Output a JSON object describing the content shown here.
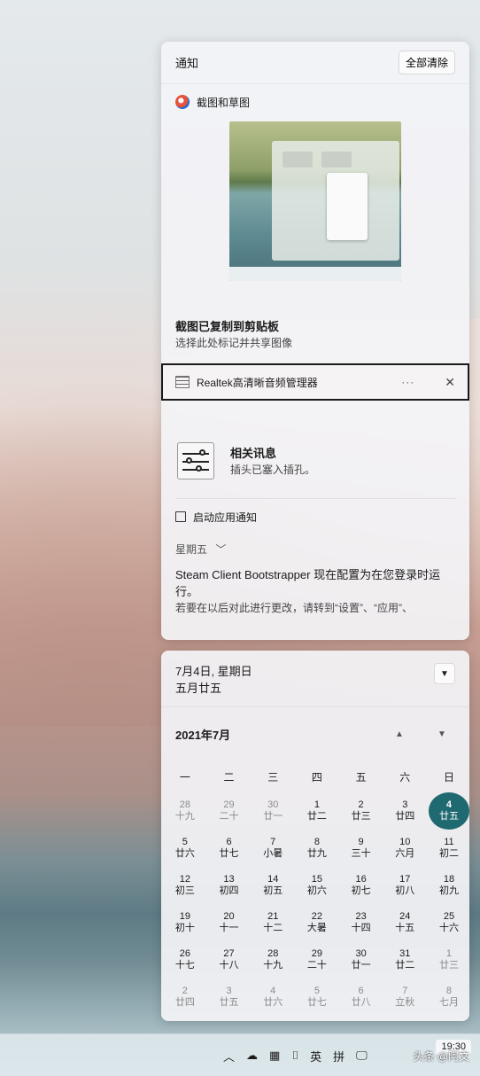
{
  "notifications": {
    "title": "通知",
    "clear_all": "全部清除",
    "snip": {
      "app": "截图和草图",
      "title": "截图已复制到剪贴板",
      "subtitle": "选择此处标记并共享图像"
    },
    "realtek": {
      "app": "Realtek高清晰音频管理器",
      "more": "···",
      "close": "✕",
      "title": "相关讯息",
      "subtitle": "插头已塞入插孔。"
    },
    "launch": "启动应用通知",
    "day_group": "星期五",
    "steam": {
      "title": "Steam Client Bootstrapper 现在配置为在您登录时运行。",
      "subtitle": "若要在以后对此进行更改，请转到“设置”、“应用”、"
    }
  },
  "calendar": {
    "date_line1": "7月4日, 星期日",
    "date_line2": "五月廿五",
    "month": "2021年7月",
    "weekdays": [
      "一",
      "二",
      "三",
      "四",
      "五",
      "六",
      "日"
    ],
    "days": [
      {
        "n": "28",
        "l": "十九",
        "dim": true
      },
      {
        "n": "29",
        "l": "二十",
        "dim": true
      },
      {
        "n": "30",
        "l": "廿一",
        "dim": true
      },
      {
        "n": "1",
        "l": "廿二"
      },
      {
        "n": "2",
        "l": "廿三"
      },
      {
        "n": "3",
        "l": "廿四"
      },
      {
        "n": "4",
        "l": "廿五",
        "today": true
      },
      {
        "n": "5",
        "l": "廿六"
      },
      {
        "n": "6",
        "l": "廿七"
      },
      {
        "n": "7",
        "l": "小暑"
      },
      {
        "n": "8",
        "l": "廿九"
      },
      {
        "n": "9",
        "l": "三十"
      },
      {
        "n": "10",
        "l": "六月"
      },
      {
        "n": "11",
        "l": "初二"
      },
      {
        "n": "12",
        "l": "初三"
      },
      {
        "n": "13",
        "l": "初四"
      },
      {
        "n": "14",
        "l": "初五"
      },
      {
        "n": "15",
        "l": "初六"
      },
      {
        "n": "16",
        "l": "初七"
      },
      {
        "n": "17",
        "l": "初八"
      },
      {
        "n": "18",
        "l": "初九"
      },
      {
        "n": "19",
        "l": "初十"
      },
      {
        "n": "20",
        "l": "十一"
      },
      {
        "n": "21",
        "l": "十二"
      },
      {
        "n": "22",
        "l": "大暑"
      },
      {
        "n": "23",
        "l": "十四"
      },
      {
        "n": "24",
        "l": "十五"
      },
      {
        "n": "25",
        "l": "十六"
      },
      {
        "n": "26",
        "l": "十七"
      },
      {
        "n": "27",
        "l": "十八"
      },
      {
        "n": "28",
        "l": "十九"
      },
      {
        "n": "29",
        "l": "二十"
      },
      {
        "n": "30",
        "l": "廿一"
      },
      {
        "n": "31",
        "l": "廿二"
      },
      {
        "n": "1",
        "l": "廿三",
        "dim": true
      },
      {
        "n": "2",
        "l": "廿四",
        "dim": true
      },
      {
        "n": "3",
        "l": "廿五",
        "dim": true
      },
      {
        "n": "4",
        "l": "廿六",
        "dim": true
      },
      {
        "n": "5",
        "l": "廿七",
        "dim": true
      },
      {
        "n": "6",
        "l": "廿八",
        "dim": true
      },
      {
        "n": "7",
        "l": "立秋",
        "dim": true
      },
      {
        "n": "8",
        "l": "七月",
        "dim": true
      }
    ],
    "today_color": "#1f6a70"
  },
  "taskbar": {
    "ime_lang": "英",
    "ime_mode": "拼",
    "time": "19:30",
    "watermark": "头条 @阿文"
  }
}
